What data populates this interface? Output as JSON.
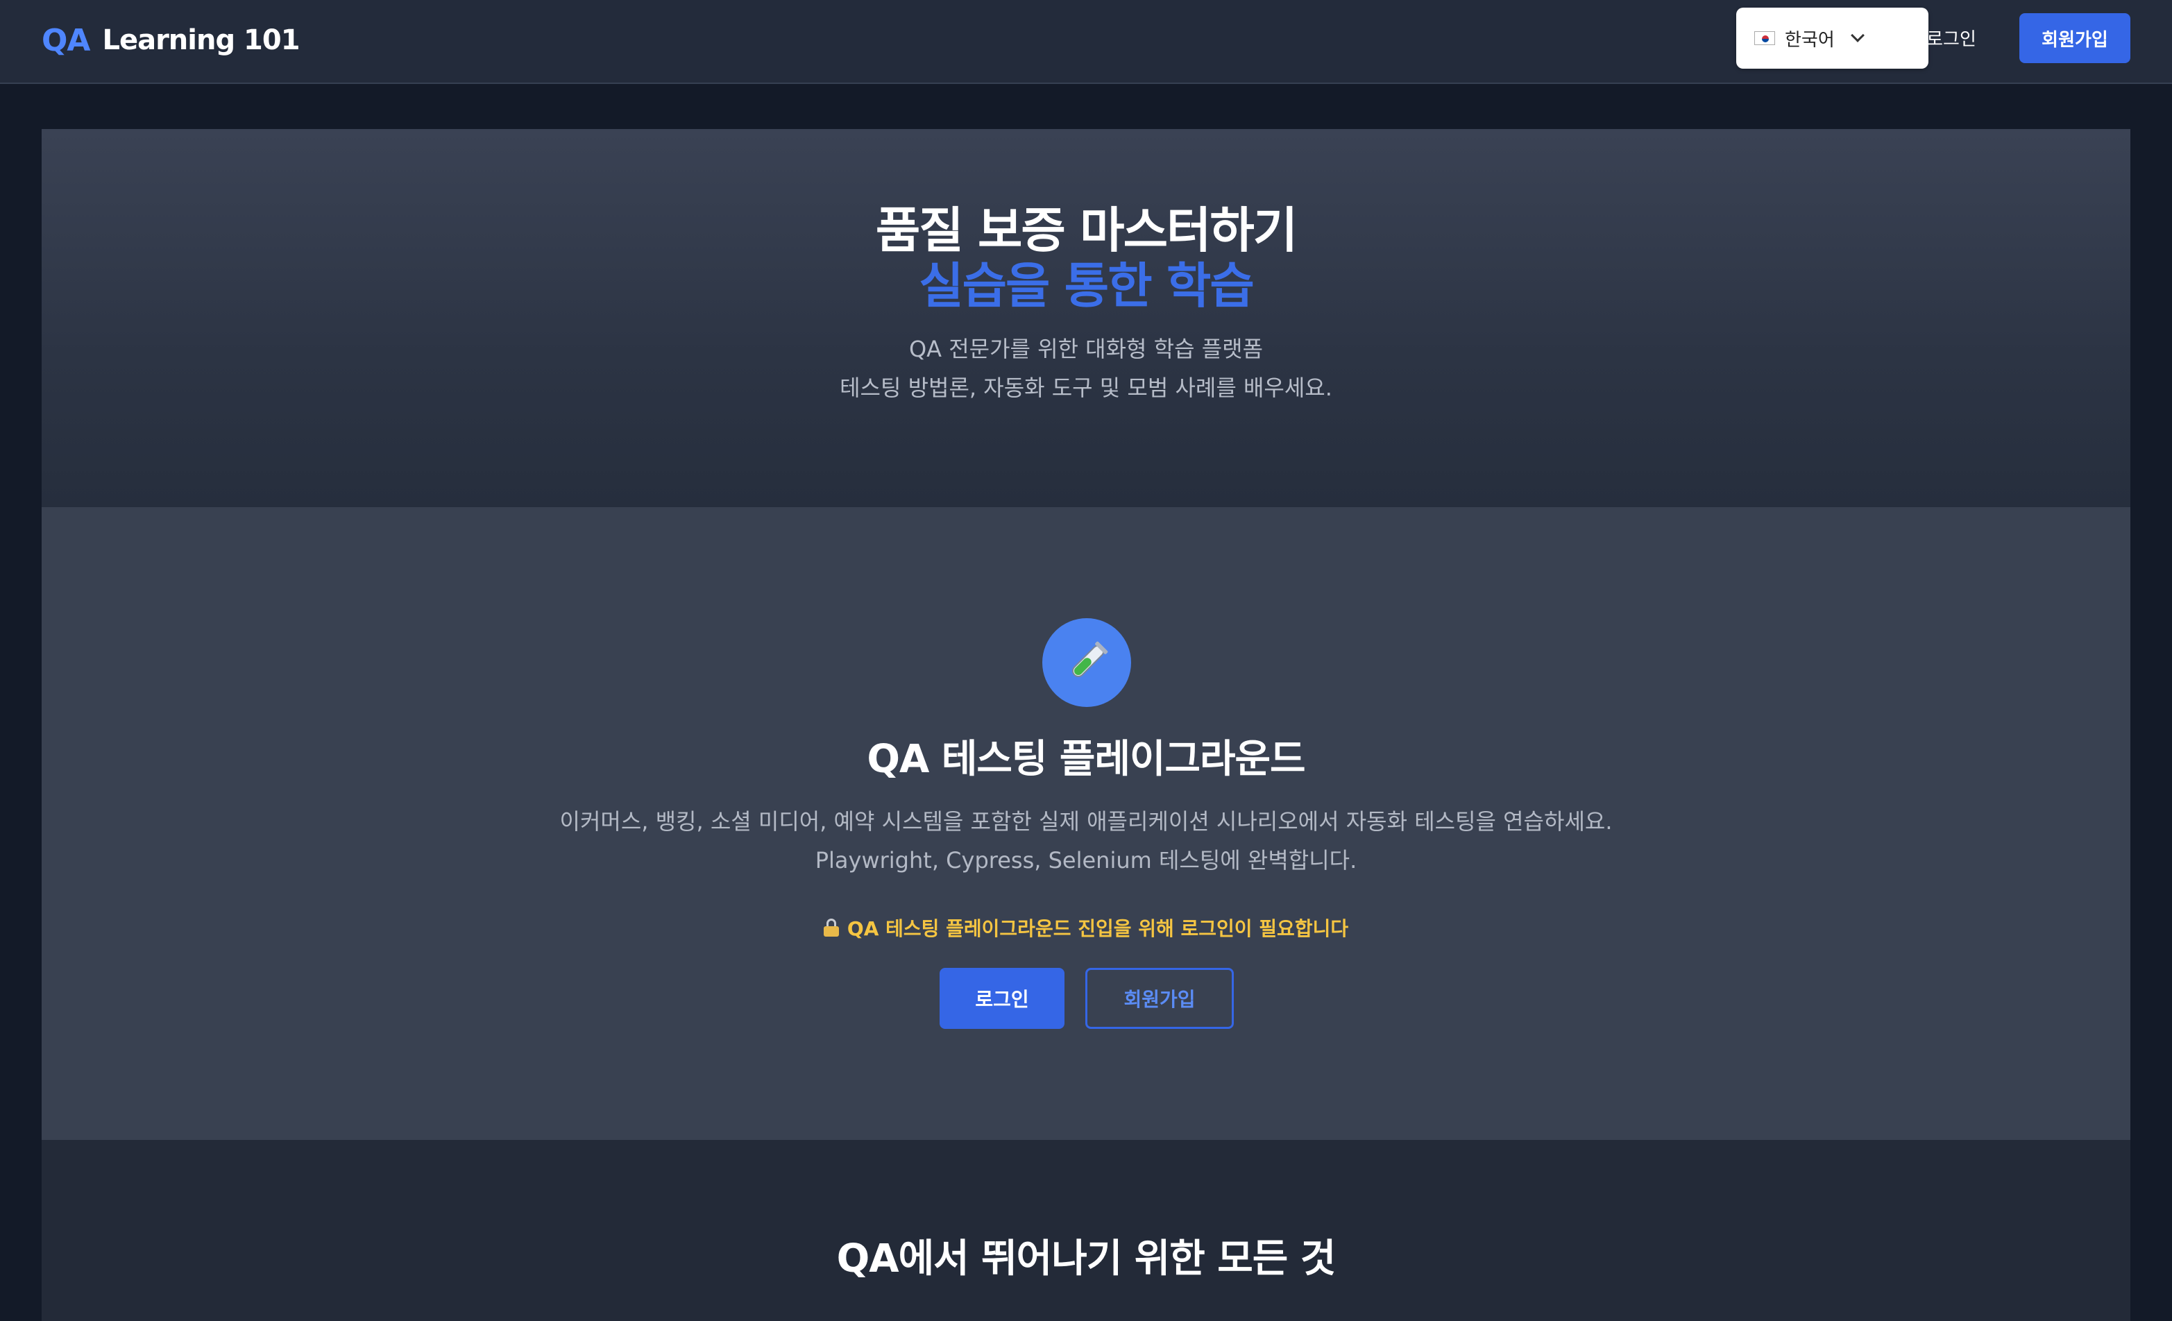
{
  "header": {
    "logo_qa": "QA",
    "logo_text": "Learning 101",
    "language": "한국어",
    "login_label": "로그인",
    "signup_label": "회원가입"
  },
  "hero": {
    "title_line1": "품질 보증 마스터하기",
    "title_line2": "실습을 통한 학습",
    "subtitle_line1": "QA 전문가를 위한 대화형 학습 플랫폼",
    "subtitle_line2": "테스팅 방법론, 자동화 도구 및 모범 사례를 배우세요."
  },
  "playground": {
    "icon": "test-tube-icon",
    "title": "QA 테스팅 플레이그라운드",
    "description_line1": "이커머스, 뱅킹, 소셜 미디어, 예약 시스템을 포함한 실제 애플리케이션 시나리오에서 자동화 테스팅을 연습하세요.",
    "description_line2": "Playwright, Cypress, Selenium 테스팅에 완벽합니다.",
    "notice": "QA 테스팅 플레이그라운드 진입을 위해 로그인이 필요합니다",
    "login_label": "로그인",
    "signup_label": "회원가입"
  },
  "features": {
    "title": "QA에서 뛰어나기 위한 모든 것"
  },
  "colors": {
    "accent": "#3566e6",
    "logo_accent": "#4f86ff",
    "notice": "#f5c542"
  }
}
